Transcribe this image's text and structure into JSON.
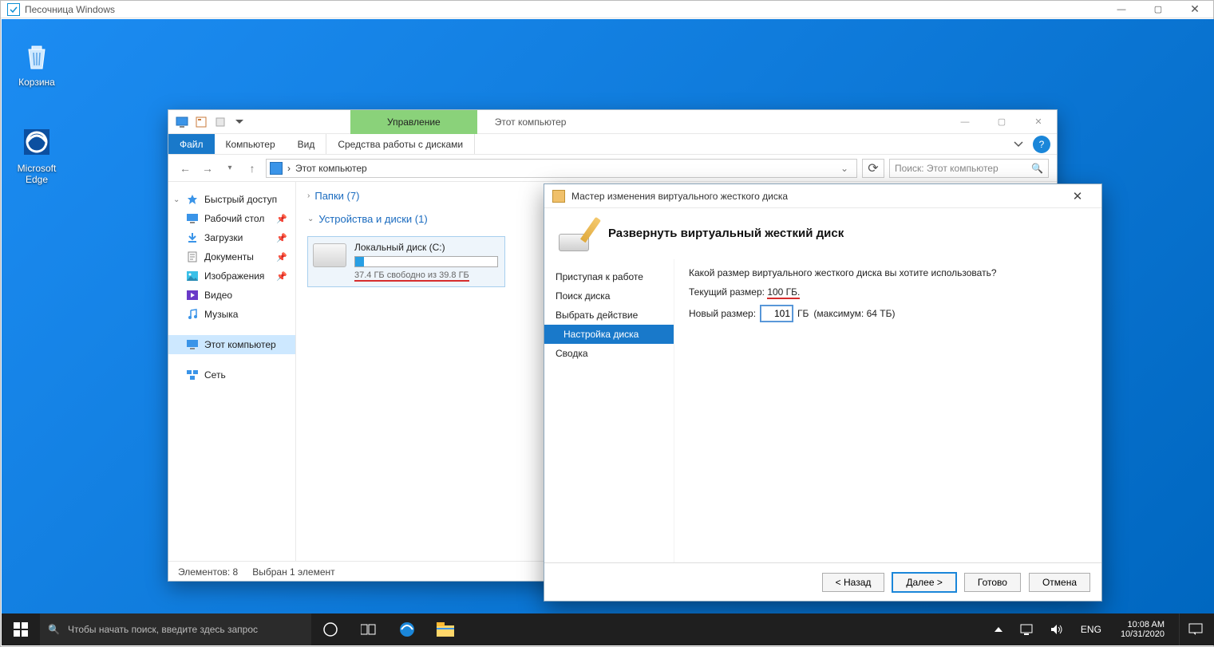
{
  "sandbox": {
    "title": "Песочница Windows"
  },
  "desktop": {
    "icons": [
      {
        "label": "Корзина"
      },
      {
        "label": "Microsoft Edge"
      }
    ]
  },
  "explorer": {
    "ribbon_tab": "Управление",
    "window_title": "Этот компьютер",
    "menubar": {
      "file": "Файл",
      "computer": "Компьютер",
      "view": "Вид",
      "disktools": "Средства работы с дисками"
    },
    "address": {
      "location": "Этот компьютер",
      "sep": "›"
    },
    "search_placeholder": "Поиск: Этот компьютер",
    "nav": {
      "quick": "Быстрый доступ",
      "desktop": "Рабочий стол",
      "downloads": "Загрузки",
      "documents": "Документы",
      "pictures": "Изображения",
      "videos": "Видео",
      "music": "Музыка",
      "thispc": "Этот компьютер",
      "network": "Сеть"
    },
    "sections": {
      "folders": "Папки (7)",
      "drives": "Устройства и диски (1)"
    },
    "drive": {
      "name": "Локальный диск (C:)",
      "free": "37.4 ГБ свободно из 39.8 ГБ"
    },
    "status": {
      "items": "Элементов: 8",
      "selected": "Выбран 1 элемент"
    }
  },
  "wizard": {
    "title": "Мастер изменения виртуального жесткого диска",
    "heading": "Развернуть виртуальный жесткий диск",
    "steps": [
      "Приступая к работе",
      "Поиск диска",
      "Выбрать действие",
      "Настройка диска",
      "Сводка"
    ],
    "question": "Какой размер виртуального жесткого диска вы хотите использовать?",
    "current_label": "Текущий размер:",
    "current_value": "100 ГБ.",
    "new_label": "Новый размер:",
    "new_value": "101",
    "unit": "ГБ",
    "max": "(максимум: 64 ТБ)",
    "buttons": {
      "back": "< Назад",
      "next": "Далее >",
      "finish": "Готово",
      "cancel": "Отмена"
    }
  },
  "taskbar": {
    "search_placeholder": "Чтобы начать поиск, введите здесь запрос",
    "lang": "ENG",
    "time": "10:08 AM",
    "date": "10/31/2020"
  }
}
